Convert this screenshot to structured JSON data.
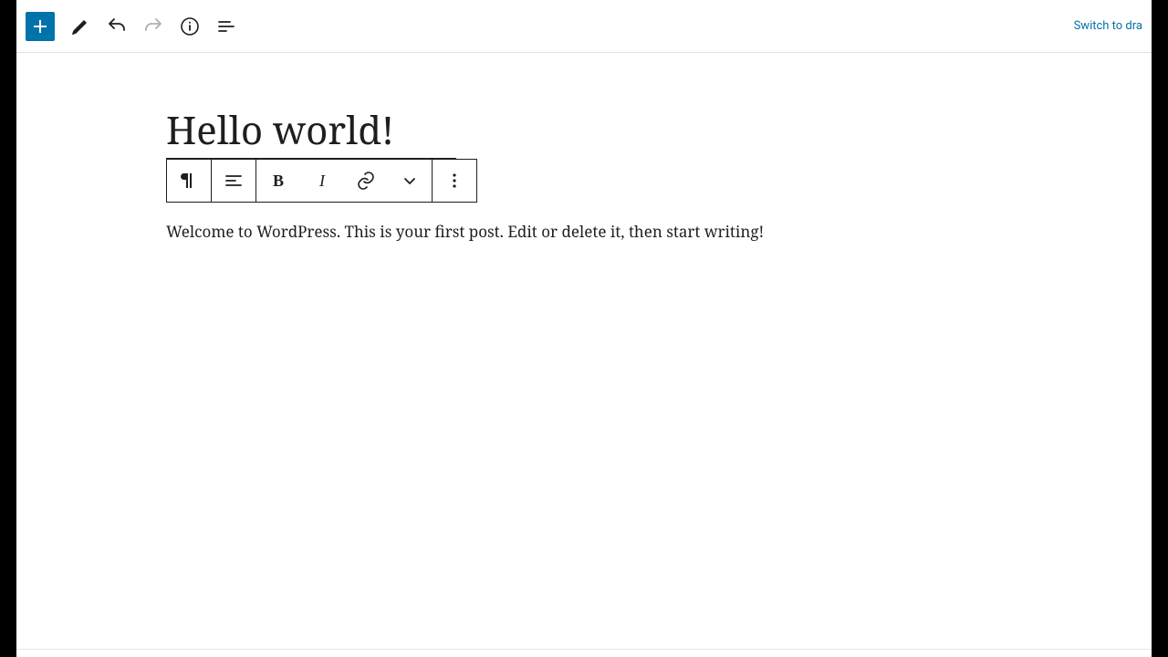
{
  "header": {
    "switch_to_draft": "Switch to dra"
  },
  "post": {
    "title": "Hello world!",
    "body": "Welcome to WordPress. This is your first post. Edit or delete it, then start writing!"
  },
  "block_toolbar": {
    "bold": "B",
    "italic": "I"
  }
}
